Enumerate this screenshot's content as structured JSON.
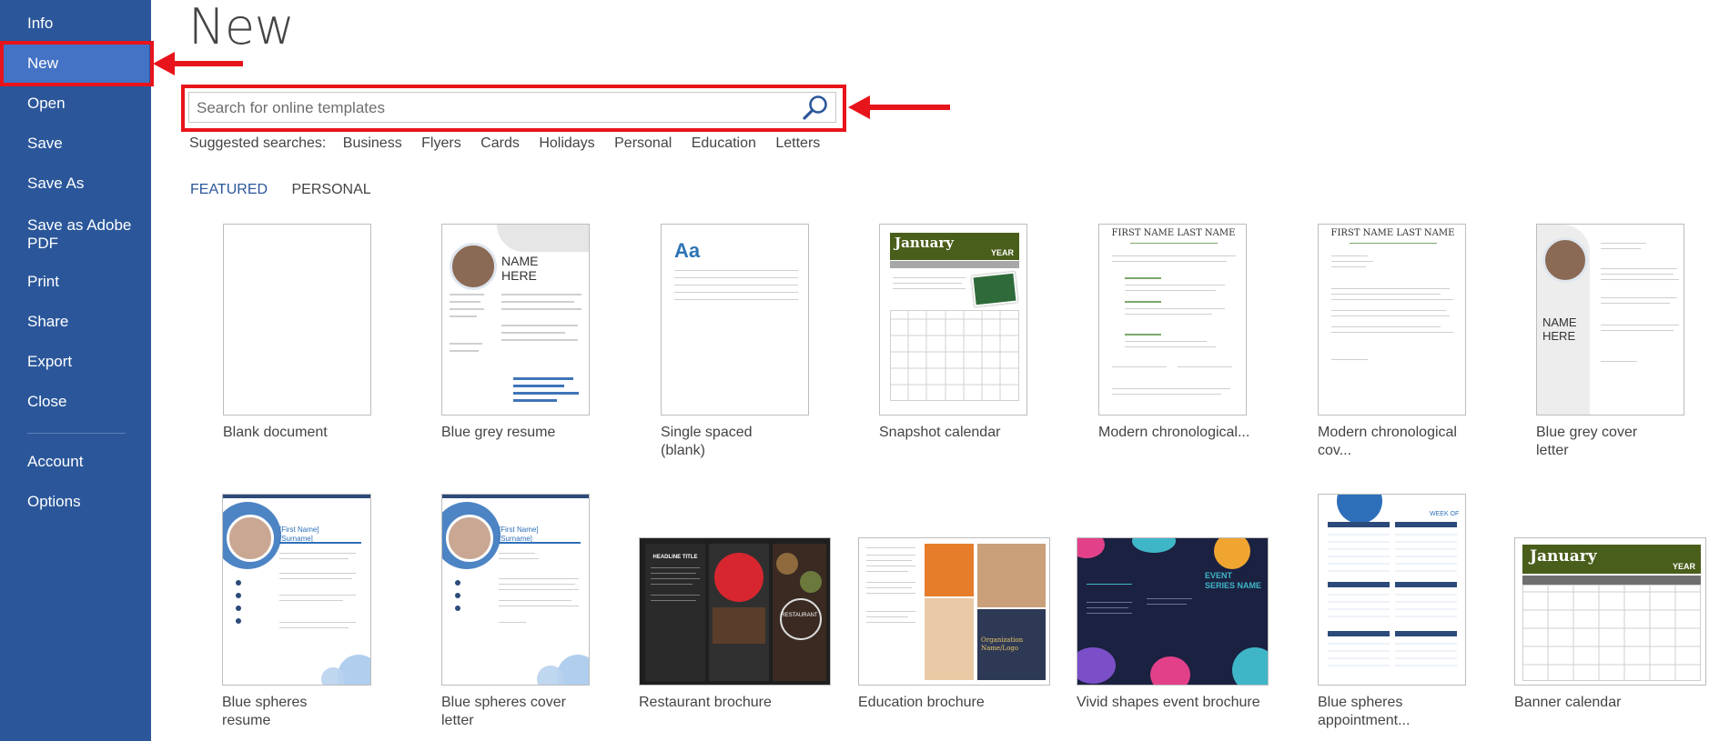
{
  "sidebar": {
    "items": [
      {
        "label": "Info"
      },
      {
        "label": "New"
      },
      {
        "label": "Open"
      },
      {
        "label": "Save"
      },
      {
        "label": "Save As"
      },
      {
        "label": "Save as Adobe PDF"
      },
      {
        "label": "Print"
      },
      {
        "label": "Share"
      },
      {
        "label": "Export"
      },
      {
        "label": "Close"
      },
      {
        "label": "Account"
      },
      {
        "label": "Options"
      }
    ]
  },
  "page": {
    "title": "New"
  },
  "search": {
    "placeholder": "Search for online templates",
    "value": ""
  },
  "suggested": {
    "label": "Suggested searches:",
    "items": [
      "Business",
      "Flyers",
      "Cards",
      "Holidays",
      "Personal",
      "Education",
      "Letters"
    ]
  },
  "tabs": [
    {
      "label": "FEATURED"
    },
    {
      "label": "PERSONAL"
    }
  ],
  "templates": [
    {
      "name": "Blank document"
    },
    {
      "name": "Blue grey resume"
    },
    {
      "name": "Single spaced (blank)"
    },
    {
      "name": "Snapshot calendar"
    },
    {
      "name": "Modern chronological..."
    },
    {
      "name": "Modern chronological cov..."
    },
    {
      "name": "Blue grey cover letter"
    },
    {
      "name": "Blue spheres resume"
    },
    {
      "name": "Blue spheres cover letter"
    },
    {
      "name": "Restaurant brochure"
    },
    {
      "name": "Education brochure"
    },
    {
      "name": "Vivid shapes event brochure"
    },
    {
      "name": "Blue spheres appointment..."
    },
    {
      "name": "Banner calendar"
    }
  ],
  "thumb_text": {
    "aa": "Aa",
    "january": "January",
    "year": "YEAR",
    "name_here": "NAME HERE",
    "first_name_last_name": "FIRST NAME LAST NAME",
    "first_name_surname": "[First Name] [Surname]",
    "headline_title": "HEADLINE TITLE",
    "restaurant": "RESTAURANT",
    "event_series_name": "EVENT SERIES NAME",
    "week_of": "WEEK OF",
    "organization": "Organization Name/Logo"
  },
  "colors": {
    "sidebar": "#2b579a",
    "sidebar_selected": "#4472c4",
    "annotation": "#e8141b",
    "accent": "#2b579a",
    "calendar_green": "#4a5e1b"
  }
}
